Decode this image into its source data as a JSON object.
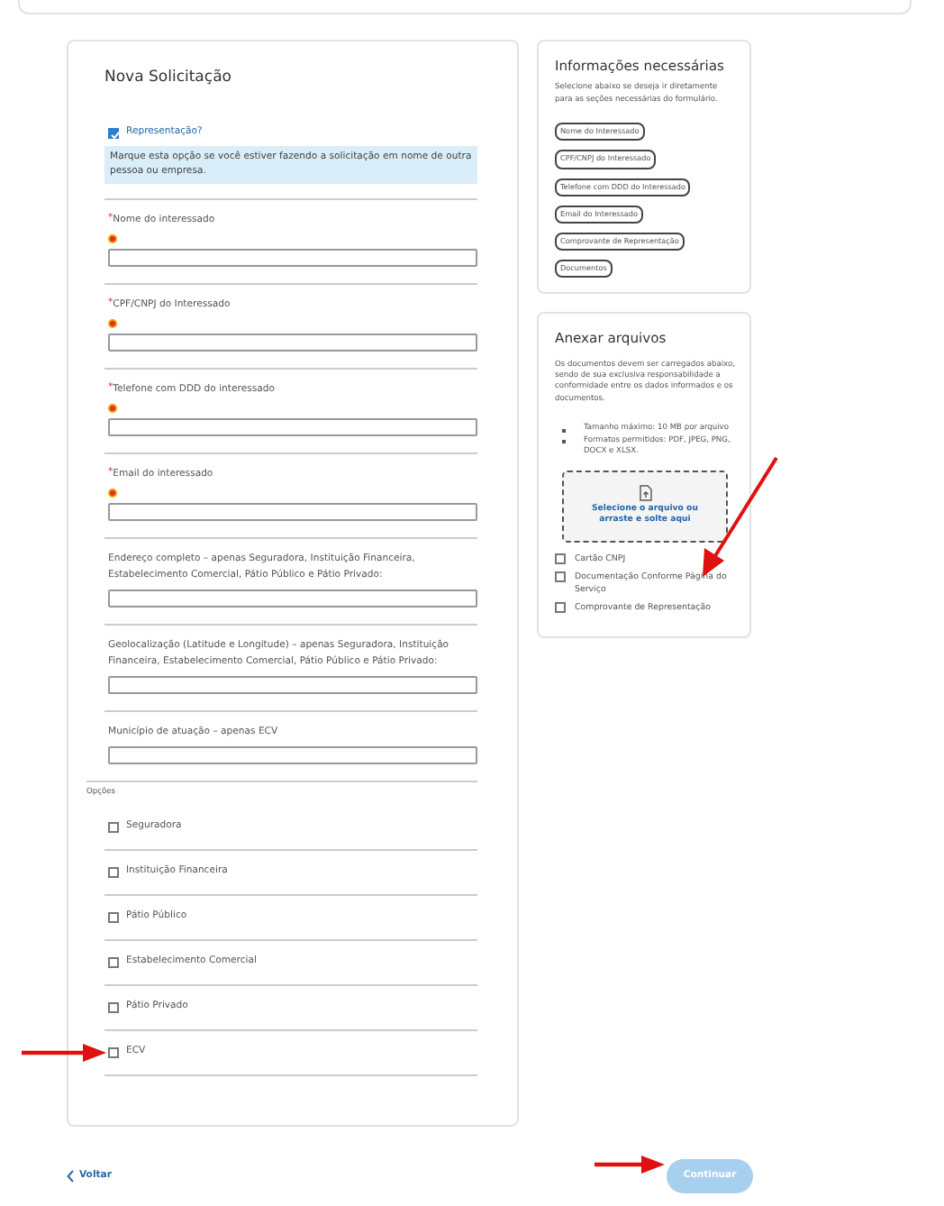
{
  "form": {
    "title": "Nova Solicitação",
    "representation": {
      "label": "Representação?",
      "checked": true,
      "note": "Marque esta opção se você estiver fazendo a solicitação em nome de outra pessoa ou empresa."
    },
    "fields": [
      {
        "label": "Nome do interessado",
        "required": true,
        "marker": "*"
      },
      {
        "label": "CPF/CNPJ do Interessado",
        "required": true,
        "marker": "*"
      },
      {
        "label": "Telefone com DDD do interessado",
        "required": true,
        "marker": "*"
      },
      {
        "label": "Email do interessado",
        "required": true,
        "marker": "*"
      },
      {
        "label": "Endereço completo – apenas Seguradora, Instituição Financeira, Estabelecimento Comercial, Pátio Público e Pátio Privado:",
        "required": false
      },
      {
        "label": "Geolocalização (Latitude e Longitude) – apenas Seguradora, Instituição Financeira, Estabelecimento Comercial, Pátio Público e Pátio Privado:",
        "required": false
      },
      {
        "label": "Município de atuação – apenas ECV",
        "required": false
      }
    ],
    "options_label": "Opções",
    "options": [
      {
        "label": "Seguradora",
        "checked": false
      },
      {
        "label": "Instituição Financeira",
        "checked": false
      },
      {
        "label": "Pátio Público",
        "checked": false
      },
      {
        "label": "Estabelecimento Comercial",
        "checked": false
      },
      {
        "label": "Pátio Privado",
        "checked": false
      },
      {
        "label": "ECV",
        "checked": false
      }
    ]
  },
  "info": {
    "title": "Informações necessárias",
    "description": "Selecione abaixo se deseja ir diretamente para as seções necessárias do formulário.",
    "links": [
      "Nome do Interessado",
      "CPF/CNPJ do Interessado",
      "Telefone com DDD do Interessado",
      "Email do Interessado",
      "Comprovante de Representação",
      "Documentos"
    ]
  },
  "attach": {
    "title": "Anexar arquivos",
    "description": "Os documentos devem ser carregados abaixo, sendo de sua exclusiva responsabilidade a conformidade entre os dados informados e os documentos.",
    "rules": [
      "Tamanho máximo: 10 MB por arquivo",
      "Formatos permitidos: PDF, JPEG, PNG, DOCX e XLSX."
    ],
    "dropzone": "Selecione o arquivo ou arraste e solte aqui",
    "documents": [
      {
        "label": "Cartão CNPJ",
        "checked": false
      },
      {
        "label": "Documentação Conforme Página do Serviço",
        "checked": false
      },
      {
        "label": "Comprovante de Representação",
        "checked": false
      }
    ]
  },
  "footer": {
    "back": "Voltar",
    "continue": {
      "label": "Continuar",
      "disabled": true
    }
  }
}
